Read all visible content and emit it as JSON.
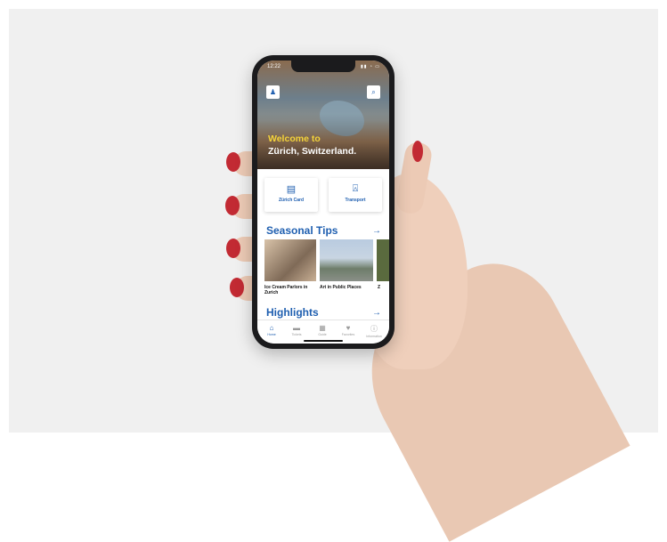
{
  "status": {
    "time": "12:22",
    "indicators": "▮▮ ◔ ▭"
  },
  "header": {
    "left_icon": "person-icon",
    "right_icon": "search-icon",
    "left_glyph": "♟",
    "right_glyph": "⌕"
  },
  "hero": {
    "line1": "Welcome to",
    "line2": "Zürich, Switzerland."
  },
  "quick_links": [
    {
      "label": "Zürich Card",
      "icon": "ticket-icon",
      "glyph": "🎫"
    },
    {
      "label": "Transport",
      "icon": "tram-icon",
      "glyph": "🚊"
    }
  ],
  "seasonal": {
    "title": "Seasonal Tips",
    "arrow": "→",
    "items": [
      {
        "label": "Ice Cream Parlors in Zurich"
      },
      {
        "label": "Art in Public Places"
      },
      {
        "label": "Z"
      }
    ]
  },
  "highlights": {
    "title": "Highlights",
    "arrow": "→"
  },
  "tabs": [
    {
      "label": "Home",
      "icon": "home-icon",
      "glyph": "⌂"
    },
    {
      "label": "Tickets",
      "icon": "ticket-icon",
      "glyph": "▬"
    },
    {
      "label": "Guide",
      "icon": "map-icon",
      "glyph": "▦"
    },
    {
      "label": "Favorites",
      "icon": "heart-icon",
      "glyph": "♥"
    },
    {
      "label": "Information",
      "icon": "info-icon",
      "glyph": "ⓘ"
    }
  ],
  "colors": {
    "accent": "#1f5fb0",
    "highlight": "#f3d33a",
    "nail": "#c22a33"
  }
}
